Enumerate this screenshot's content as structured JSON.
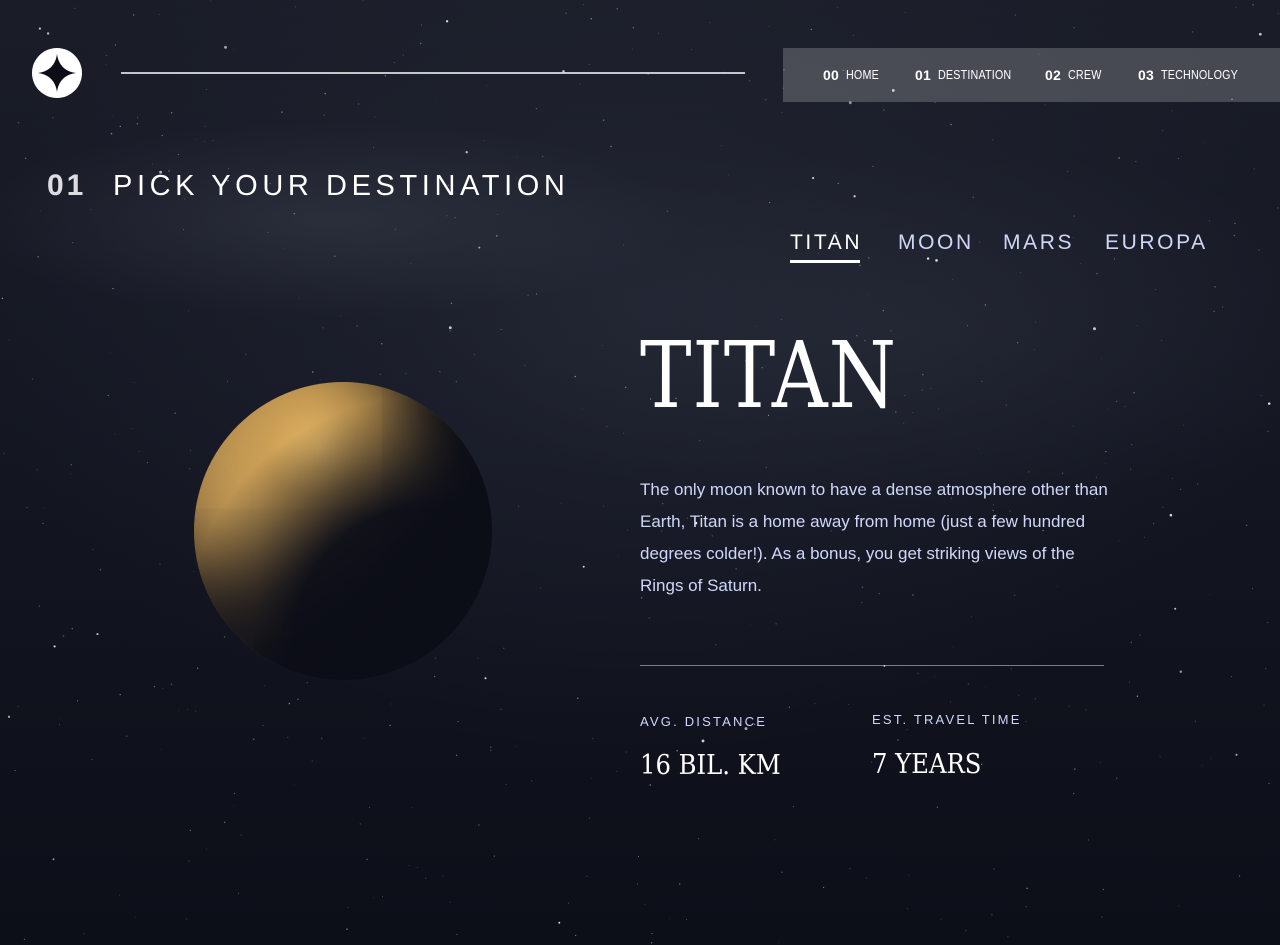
{
  "nav": {
    "items": [
      {
        "number": "00",
        "label": "HOME"
      },
      {
        "number": "01",
        "label": "DESTINATION"
      },
      {
        "number": "02",
        "label": "CREW"
      },
      {
        "number": "03",
        "label": "TECHNOLOGY"
      }
    ],
    "active_index": 1
  },
  "page": {
    "heading_number": "01",
    "heading_text": "PICK YOUR DESTINATION"
  },
  "tabs": {
    "items": [
      "TITAN",
      "MOON",
      "MARS",
      "EUROPA"
    ],
    "active_index": 0
  },
  "destination": {
    "name": "TITAN",
    "description": "The only moon known to have a dense atmosphere other than Earth, Titan is a home away from home (just a few hundred degrees colder!). As a bonus, you get striking views of the Rings of Saturn.",
    "distance_label": "AVG. DISTANCE",
    "distance_value": "16 BIL. KM",
    "travel_label": "EST. TRAVEL TIME",
    "travel_value": "7 YEARS"
  },
  "colors": {
    "background": "#0b0d17",
    "accent_text": "#d0d6f9",
    "white": "#ffffff"
  },
  "icons": {
    "logo": "four-point-star-logo-icon"
  }
}
